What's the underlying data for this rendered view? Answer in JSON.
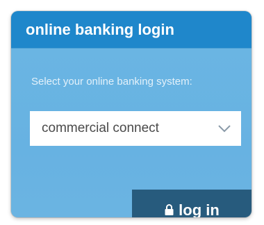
{
  "header": {
    "title": "online banking login"
  },
  "form": {
    "prompt": "Select your online banking system:",
    "selected_system": "commercial connect",
    "dropdown_icon": "chevron-down-icon"
  },
  "actions": {
    "login_label": "log in",
    "login_icon": "lock-icon"
  },
  "colors": {
    "header_bg": "#1f87cb",
    "body_bg": "#67b2e2",
    "button_bg": "#275b7d",
    "text_white": "#ffffff",
    "select_text": "#4a4a4a"
  }
}
